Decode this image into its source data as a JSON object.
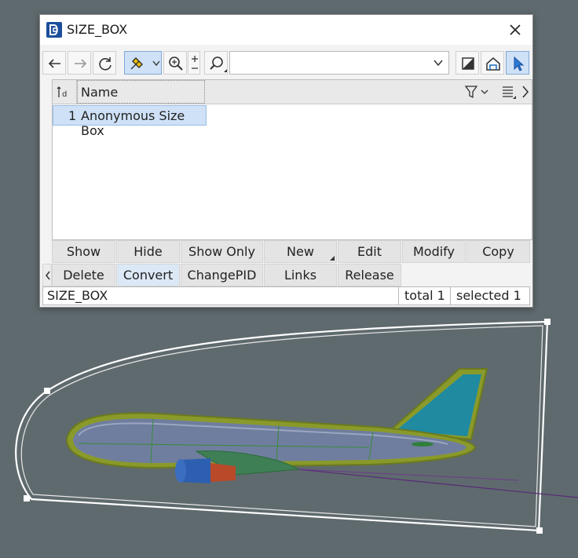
{
  "window": {
    "title": "SIZE_BOX"
  },
  "toolbar": {
    "filter_value": ""
  },
  "grid": {
    "columns": [
      "Name"
    ],
    "rows": [
      {
        "index": "1",
        "name": "Anonymous Size Box"
      }
    ]
  },
  "buttons_row1": [
    "Show",
    "Hide",
    "Show Only",
    "New",
    "Edit",
    "Modify",
    "Copy"
  ],
  "buttons_row2": [
    "Delete",
    "Convert",
    "ChangePID",
    "Links",
    "Release"
  ],
  "status": {
    "name": "SIZE_BOX",
    "total": "total 1",
    "selected": "selected 1"
  },
  "colors": {
    "accent": "#1b4f9c",
    "selection": "#cfe1f7",
    "viewport": "#5f6a6e"
  }
}
